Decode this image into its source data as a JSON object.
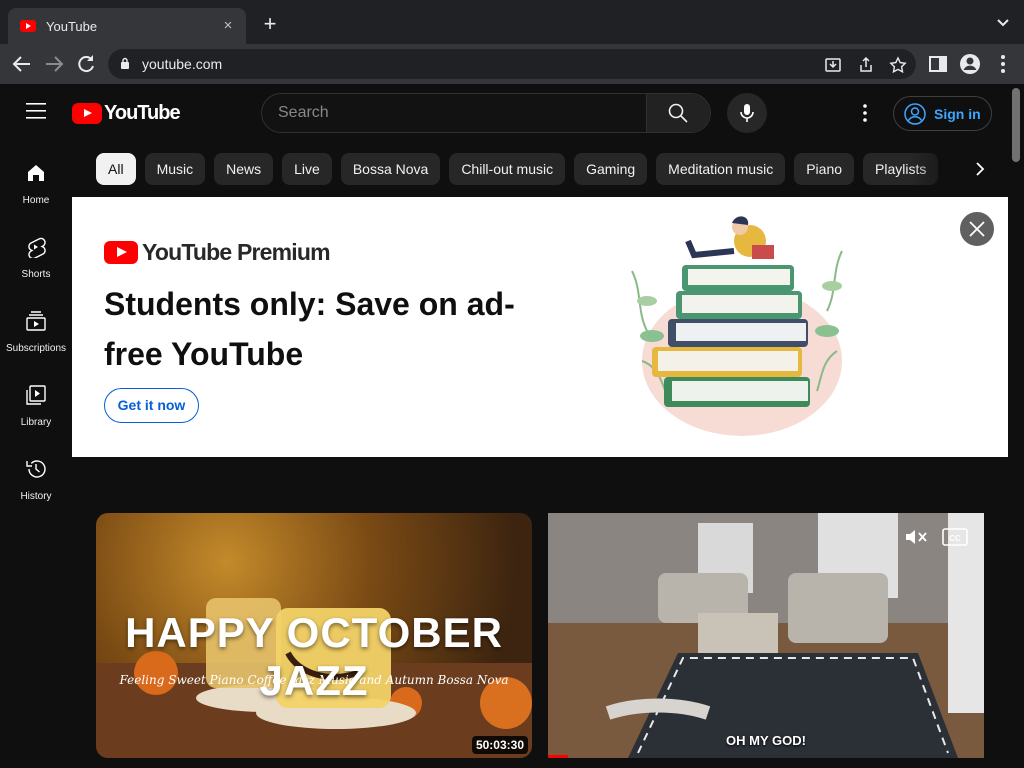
{
  "browser": {
    "tab_title": "YouTube",
    "tab_close": "×",
    "new_tab": "+",
    "url": "youtube.com"
  },
  "header": {
    "logo_text": "YouTube",
    "search_placeholder": "Search",
    "signin_label": "Sign in"
  },
  "sidebar": {
    "items": [
      {
        "label": "Home",
        "icon": "home-icon"
      },
      {
        "label": "Shorts",
        "icon": "shorts-icon"
      },
      {
        "label": "Subscriptions",
        "icon": "subscriptions-icon"
      },
      {
        "label": "Library",
        "icon": "library-icon"
      },
      {
        "label": "History",
        "icon": "history-icon"
      }
    ]
  },
  "chips": [
    "All",
    "Music",
    "News",
    "Live",
    "Bossa Nova",
    "Chill-out music",
    "Gaming",
    "Meditation music",
    "Piano",
    "Playlists"
  ],
  "promo": {
    "brand": "YouTube Premium",
    "headline": "Students only: Save on ad-free YouTube",
    "cta": "Get it now"
  },
  "videos": [
    {
      "overlay_title": "HAPPY OCTOBER JAZZ",
      "overlay_subtitle": "Feeling Sweet Piano Coffee Jazz Music and Autumn Bossa Nova",
      "duration": "50:03:30"
    },
    {
      "caption": "OH MY GOD!"
    }
  ],
  "colors": {
    "brand_red": "#ff0000",
    "link_blue": "#3ea6ff",
    "cta_blue": "#065fd4",
    "background": "#0f0f0f"
  }
}
